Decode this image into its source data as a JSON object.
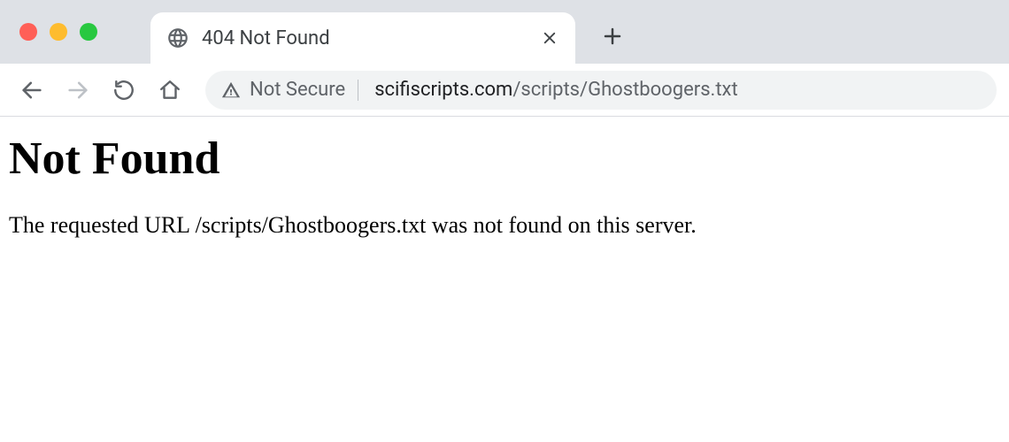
{
  "browser": {
    "tab": {
      "title": "404 Not Found"
    },
    "address": {
      "security_label": "Not Secure",
      "domain": "scifiscripts.com",
      "path": "/scripts/Ghostboogers.txt"
    }
  },
  "page": {
    "heading": "Not Found",
    "message": "The requested URL /scripts/Ghostboogers.txt was not found on this server."
  }
}
